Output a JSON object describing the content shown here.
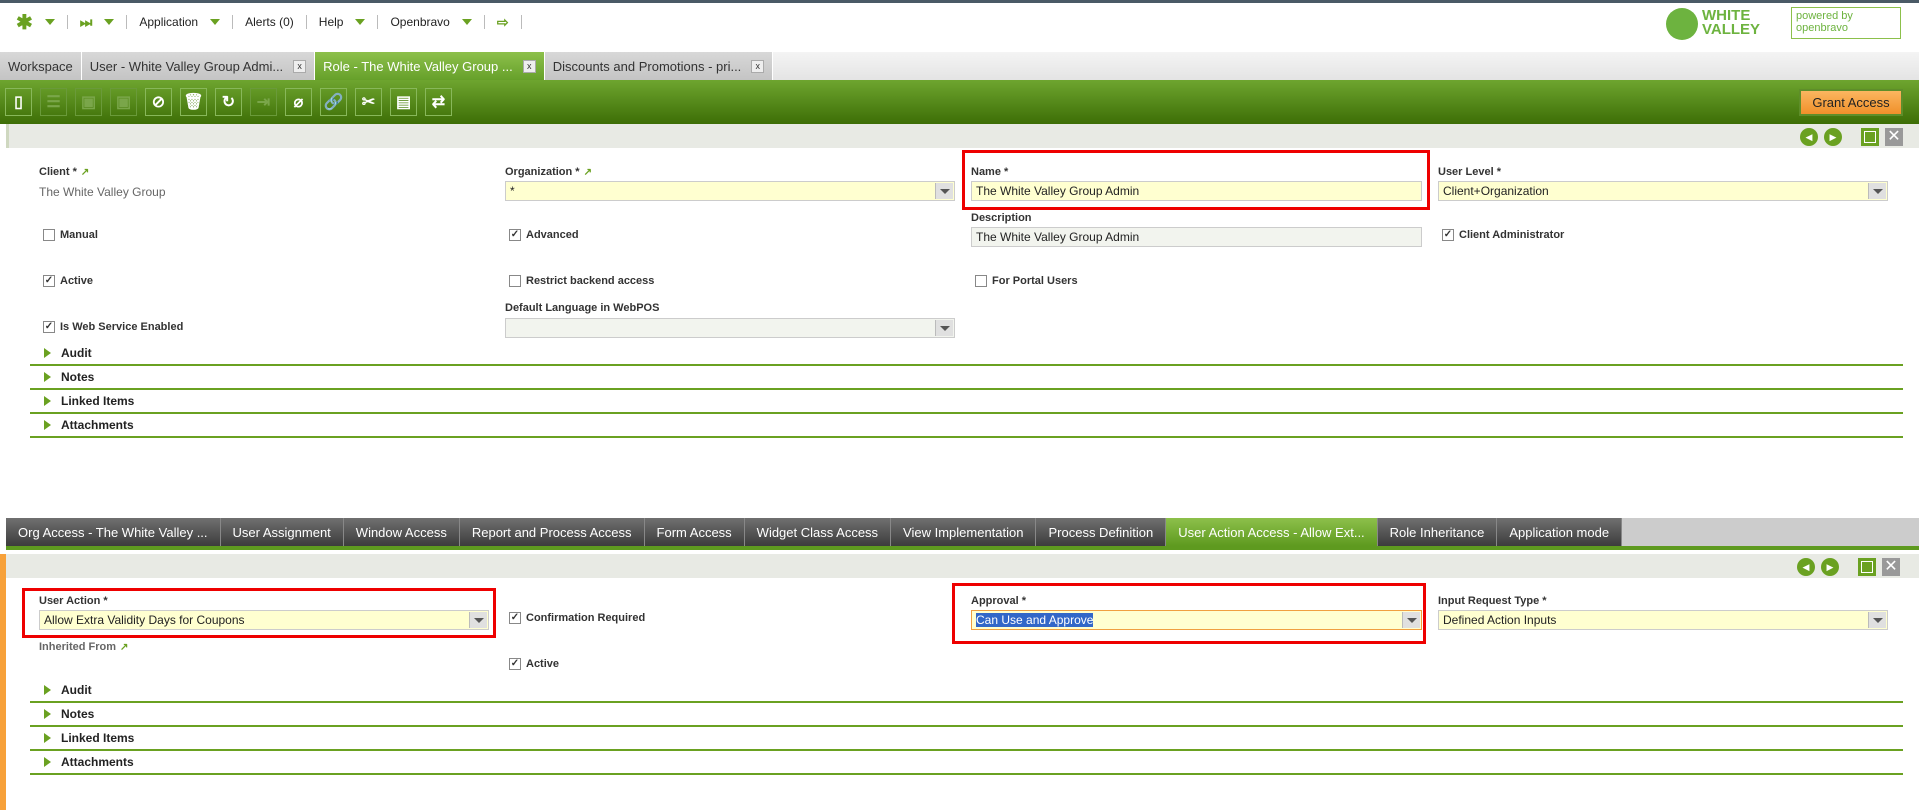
{
  "topnav": {
    "application": "Application",
    "alerts": "Alerts (0)",
    "help": "Help",
    "user": "Openbravo"
  },
  "logos": {
    "white_valley": "WHITE VALLEY",
    "openbravo": "powered by openbravo"
  },
  "tabs": [
    {
      "label": "Workspace"
    },
    {
      "label": "User - White Valley Group Admi..."
    },
    {
      "label": "Role - The White Valley Group ..."
    },
    {
      "label": "Discounts and Promotions - pri..."
    }
  ],
  "toolbar": {
    "grant_access": "Grant Access"
  },
  "role_form": {
    "client_label": "Client *",
    "client_value": "The White Valley Group",
    "org_label": "Organization *",
    "org_value": "*",
    "name_label": "Name *",
    "name_value": "The White Valley Group Admin",
    "user_level_label": "User Level *",
    "user_level_value": "Client+Organization",
    "description_label": "Description",
    "description_value": "The White Valley Group Admin",
    "manual": "Manual",
    "advanced": "Advanced",
    "client_admin": "Client Administrator",
    "active": "Active",
    "restrict_backend": "Restrict backend access",
    "portal_users": "For Portal Users",
    "default_lang_label": "Default Language in WebPOS",
    "default_lang_value": "",
    "web_service": "Is Web Service Enabled",
    "sections": [
      "Audit",
      "Notes",
      "Linked Items",
      "Attachments"
    ]
  },
  "child_tabs": [
    "Org Access - The White Valley ...",
    "User Assignment",
    "Window Access",
    "Report and Process Access",
    "Form Access",
    "Widget Class Access",
    "View Implementation",
    "Process Definition",
    "User Action Access - Allow Ext...",
    "Role Inheritance",
    "Application mode"
  ],
  "action_form": {
    "user_action_label": "User Action *",
    "user_action_value": "Allow Extra Validity Days for Coupons",
    "confirmation": "Confirmation Required",
    "approval_label": "Approval *",
    "approval_value": "Can Use and Approve",
    "input_type_label": "Input Request Type *",
    "input_type_value": "Defined Action Inputs",
    "inherited_label": "Inherited From",
    "active": "Active",
    "sections": [
      "Audit",
      "Notes",
      "Linked Items",
      "Attachments"
    ]
  }
}
